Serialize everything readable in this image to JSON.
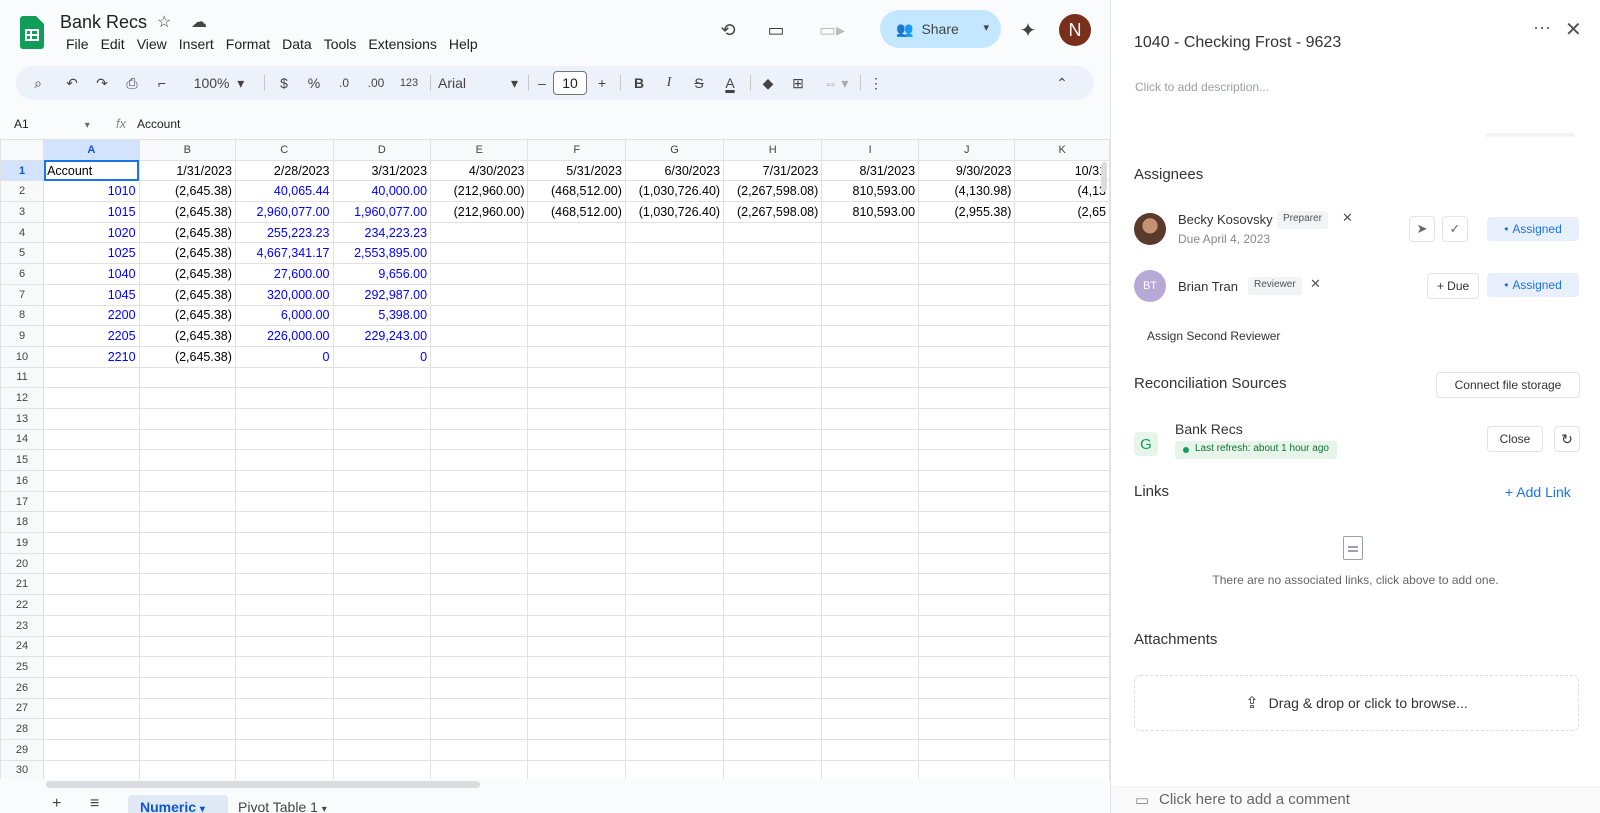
{
  "sheets": {
    "doc_title": "Bank Recs",
    "menu": [
      "File",
      "Edit",
      "View",
      "Insert",
      "Format",
      "Data",
      "Tools",
      "Extensions",
      "Help"
    ],
    "share_label": "Share",
    "avatar_initial": "N",
    "toolbar": {
      "zoom": "100%",
      "currency": "$",
      "percent": "%",
      "dec_decrease": ".0",
      "dec_increase": ".00",
      "format_num": "123",
      "font": "Arial",
      "font_size": "10",
      "bold": "B",
      "italic": "I"
    },
    "formula_bar": {
      "cell_ref": "A1",
      "fx": "fx",
      "content": "Account"
    },
    "columns": [
      "A",
      "B",
      "C",
      "D",
      "E",
      "F",
      "G",
      "H",
      "I",
      "J",
      "K"
    ],
    "rows": [
      [
        "Account",
        "1/31/2023",
        "2/28/2023",
        "3/31/2023",
        "4/30/2023",
        "5/31/2023",
        "6/30/2023",
        "7/31/2023",
        "8/31/2023",
        "9/30/2023",
        "10/31"
      ],
      [
        "1010",
        "(2,645.38)",
        "40,065.44",
        "40,000.00",
        "(212,960.00)",
        "(468,512.00)",
        "(1,030,726.40)",
        "(2,267,598.08)",
        "810,593.00",
        "(4,130.98)",
        "(4,13"
      ],
      [
        "1015",
        "(2,645.38)",
        "2,960,077.00",
        "1,960,077.00",
        "(212,960.00)",
        "(468,512.00)",
        "(1,030,726.40)",
        "(2,267,598.08)",
        "810,593.00",
        "(2,955.38)",
        "(2,65"
      ],
      [
        "1020",
        "(2,645.38)",
        "255,223.23",
        "234,223.23",
        "",
        "",
        "",
        "",
        "",
        "",
        ""
      ],
      [
        "1025",
        "(2,645.38)",
        "4,667,341.17",
        "2,553,895.00",
        "",
        "",
        "",
        "",
        "",
        "",
        ""
      ],
      [
        "1040",
        "(2,645.38)",
        "27,600.00",
        "9,656.00",
        "",
        "",
        "",
        "",
        "",
        "",
        ""
      ],
      [
        "1045",
        "(2,645.38)",
        "320,000.00",
        "292,987.00",
        "",
        "",
        "",
        "",
        "",
        "",
        ""
      ],
      [
        "2200",
        "(2,645.38)",
        "6,000.00",
        "5,398.00",
        "",
        "",
        "",
        "",
        "",
        "",
        ""
      ],
      [
        "2205",
        "(2,645.38)",
        "226,000.00",
        "229,243.00",
        "",
        "",
        "",
        "",
        "",
        "",
        ""
      ],
      [
        "2210",
        "(2,645.38)",
        "0",
        "0",
        "",
        "",
        "",
        "",
        "",
        "",
        ""
      ]
    ],
    "row_count": 30,
    "tabs": {
      "active": "Numeric",
      "other": "Pivot Table 1"
    }
  },
  "panel": {
    "title": "1040 - Checking Frost - 9623",
    "description_placeholder": "Click to add description...",
    "assignees_heading": "Assignees",
    "assignees": [
      {
        "name": "Becky Kosovsky",
        "role": "Preparer",
        "due": "Due April 4, 2023",
        "status": "Assigned"
      },
      {
        "name": "Brian Tran",
        "initials": "BT",
        "role": "Reviewer",
        "due_button": "+ Due",
        "status": "Assigned"
      }
    ],
    "assign_second_reviewer": "Assign Second Reviewer",
    "sources_heading": "Reconciliation Sources",
    "connect_storage": "Connect file storage",
    "source": {
      "name": "Bank Recs",
      "logo_letter": "G",
      "refresh": "Last refresh: about 1 hour ago",
      "close_label": "Close"
    },
    "links_heading": "Links",
    "add_link": "+ Add Link",
    "links_empty": "There are no associated links, click above to add one.",
    "attachments_heading": "Attachments",
    "dropzone": "Drag & drop or click to browse...",
    "comment_placeholder": "Click here to add a comment"
  }
}
